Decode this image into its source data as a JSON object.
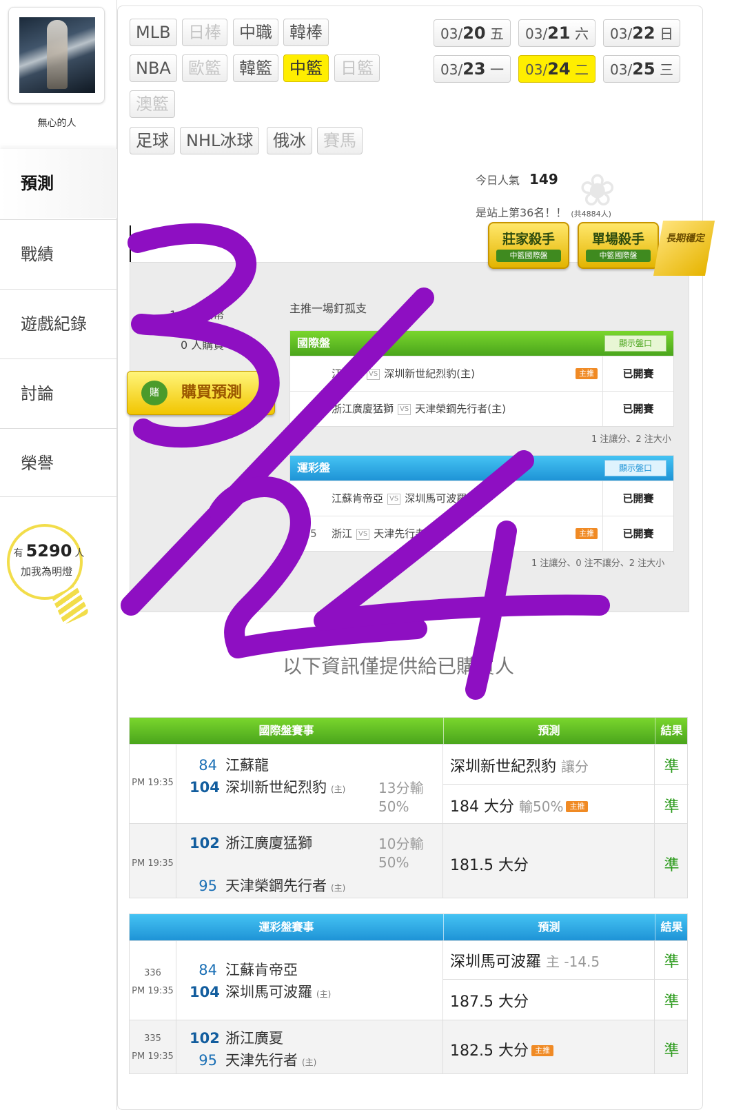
{
  "user": {
    "nickname": "無心的人"
  },
  "nav": {
    "items": [
      {
        "label": "預測",
        "active": true
      },
      {
        "label": "戰績"
      },
      {
        "label": "遊戲紀錄"
      },
      {
        "label": "討論"
      },
      {
        "label": "榮譽"
      }
    ]
  },
  "fans": {
    "prefix": "有",
    "count": "5290",
    "suffix": "人",
    "label": "加我為明燈"
  },
  "leagues": [
    [
      {
        "label": "MLB"
      },
      {
        "label": "日棒",
        "disabled": true
      },
      {
        "label": "中職"
      },
      {
        "label": "韓棒"
      }
    ],
    [
      {
        "label": "NBA"
      },
      {
        "label": "歐籃",
        "disabled": true
      },
      {
        "label": "韓籃"
      },
      {
        "label": "中籃",
        "selected": true
      },
      {
        "label": "日籃",
        "disabled": true
      }
    ],
    [
      {
        "label": "澳籃",
        "disabled": true
      }
    ],
    [
      {
        "label": "足球"
      },
      {
        "label": "NHL冰球"
      },
      {
        "label": "俄冰"
      },
      {
        "label": "賽馬",
        "disabled": true
      }
    ]
  ],
  "dates": [
    {
      "md": "03/",
      "day": "20",
      "wd": "五"
    },
    {
      "md": "03/",
      "day": "21",
      "wd": "六"
    },
    {
      "md": "03/",
      "day": "22",
      "wd": "日"
    },
    {
      "md": "03/",
      "day": "23",
      "wd": "一"
    },
    {
      "md": "03/",
      "day": "24",
      "wd": "二",
      "selected": true
    },
    {
      "md": "03/",
      "day": "25",
      "wd": "三"
    }
  ],
  "stats": {
    "popularity_label": "今日人氣",
    "popularity": "149",
    "rank_text": "是站上第36名！！",
    "rank_total": "(共4884人)"
  },
  "badges": [
    {
      "title": "莊家殺手",
      "sub": "中籃國際盤"
    },
    {
      "title": "單場殺手",
      "sub": "中籃國際盤"
    }
  ],
  "ribbon": "長期穩定",
  "panel": {
    "coins_text": "1　　 點幣",
    "buyers_text": "0 人購買",
    "buy_button": "購買預測",
    "buy_icon": "賭",
    "main_pick": "主推一場釘孤支",
    "intl": {
      "header": "國際盤",
      "show": "顯示盤口",
      "rows": [
        {
          "num": "",
          "away": "江蘇龍",
          "home": "深圳新世紀烈豹(主)",
          "main": "主推",
          "status": "已開賽"
        },
        {
          "num": "",
          "away": "浙江廣廈猛獅",
          "home": "天津榮鋼先行者(主)",
          "main": "",
          "status": "已開賽"
        }
      ],
      "note": "1 注讓分、2 注大小"
    },
    "lottery": {
      "header": "運彩盤",
      "show": "顯示盤口",
      "rows": [
        {
          "num": "",
          "away": "江蘇肯帝亞",
          "home": "深圳馬可波羅(主)",
          "main": "",
          "status": "已開賽"
        },
        {
          "num": "335",
          "away": "浙江",
          "home": "天津先行者(主)",
          "main": "主推",
          "status": "已開賽"
        }
      ],
      "note": "1 注讓分、0 注不讓分、2 注大小"
    }
  },
  "restricted_note": "以下資訊僅提供給已購買人",
  "intl_results": {
    "headers": [
      "國際盤賽事",
      "預測",
      "結果"
    ],
    "games": [
      {
        "time": "PM 19:35",
        "away_score": "84",
        "away": "江蘇龍",
        "home_score": "104",
        "home": "深圳新世紀烈豹",
        "home_tag": "(主)",
        "loss": "13分輸",
        "pct": "50%",
        "picks": [
          {
            "text": "深圳新世紀烈豹",
            "mark": "讓分",
            "main": "",
            "result": "準"
          },
          {
            "text": "184 大分",
            "mark": "輸50%",
            "main": "主推",
            "result": "準"
          }
        ]
      },
      {
        "time": "PM 19:35",
        "away_score": "102",
        "away": "浙江廣廈猛獅",
        "home_score": "95",
        "home": "天津榮鋼先行者",
        "home_tag": "(主)",
        "loss": "10分輸",
        "pct": "50%",
        "picks": [
          {
            "text": "181.5 大分",
            "mark": "",
            "main": "",
            "result": "準"
          }
        ]
      }
    ]
  },
  "lottery_results": {
    "headers": [
      "運彩盤賽事",
      "預測",
      "結果"
    ],
    "games": [
      {
        "num": "336",
        "time": "PM 19:35",
        "away_score": "84",
        "away": "江蘇肯帝亞",
        "home_score": "104",
        "home": "深圳馬可波羅",
        "home_tag": "(主)",
        "picks": [
          {
            "text": "深圳馬可波羅",
            "mark": "主 -14.5",
            "main": "",
            "result": "準"
          },
          {
            "text": "187.5 大分",
            "mark": "",
            "main": "",
            "result": "準"
          }
        ]
      },
      {
        "num": "335",
        "time": "PM 19:35",
        "away_score": "102",
        "away": "浙江廣夏",
        "home_score": "95",
        "home": "天津先行者",
        "home_tag": "(主)",
        "picks": [
          {
            "text": "182.5 大分",
            "mark": "",
            "main": "主推",
            "result": "準"
          }
        ]
      }
    ]
  },
  "annotation": {
    "text": "3/24",
    "color": "#8e0fc2"
  }
}
